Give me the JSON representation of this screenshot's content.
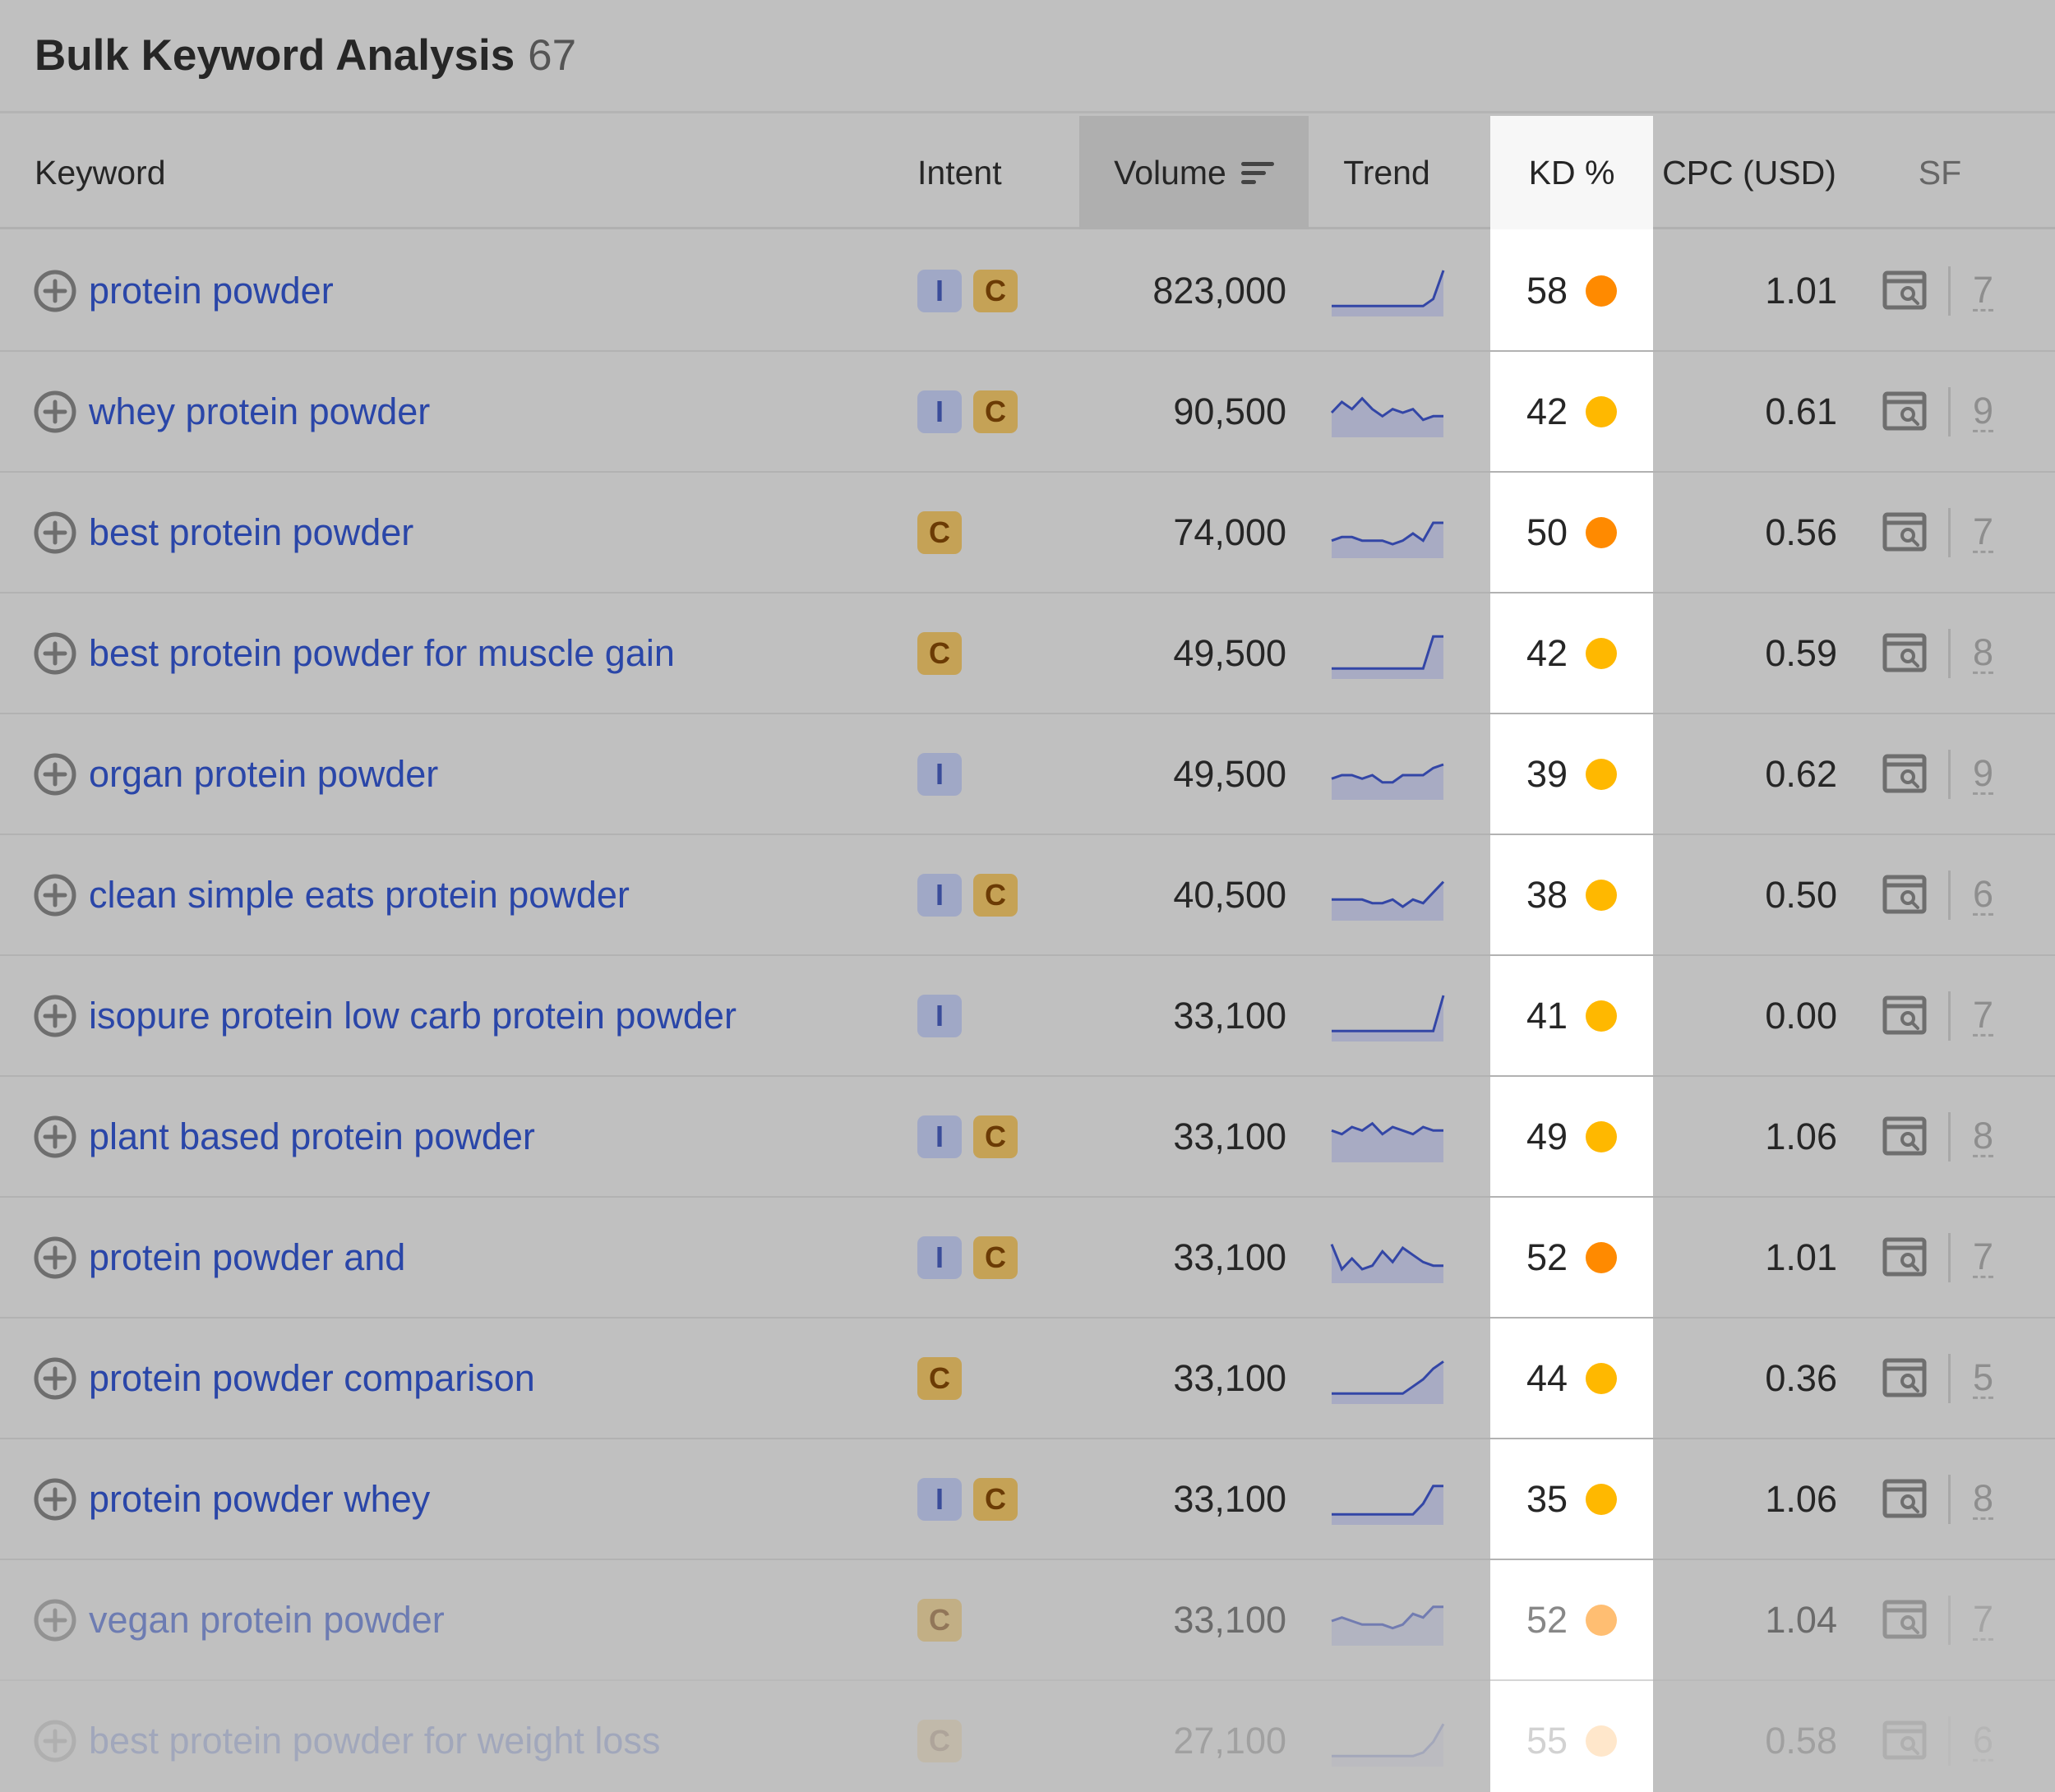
{
  "header": {
    "title": "Bulk Keyword Analysis",
    "count": "67"
  },
  "columns": {
    "keyword": "Keyword",
    "intent": "Intent",
    "volume": "Volume",
    "trend": "Trend",
    "kd": "KD %",
    "cpc": "CPC (USD)",
    "sf": "SF"
  },
  "colors": {
    "kd_orange": "#ff8a00",
    "kd_yellow": "#ffb800",
    "link": "#2a46a8",
    "intent_i": "#a0a8c6",
    "intent_c": "#c5a256"
  },
  "rows": [
    {
      "keyword": "protein powder",
      "intents": [
        "I",
        "C"
      ],
      "volume": "823,000",
      "trend": [
        2,
        2,
        2,
        2,
        2,
        2,
        2,
        2,
        2,
        2,
        4,
        12
      ],
      "kd": "58",
      "kd_color": "orange",
      "cpc": "1.01",
      "sf": "7"
    },
    {
      "keyword": "whey protein powder",
      "intents": [
        "I",
        "C"
      ],
      "volume": "90,500",
      "trend": [
        6,
        9,
        7,
        10,
        7,
        5,
        7,
        6,
        7,
        4,
        5,
        5
      ],
      "kd": "42",
      "kd_color": "yellow",
      "cpc": "0.61",
      "sf": "9"
    },
    {
      "keyword": "best protein powder",
      "intents": [
        "C"
      ],
      "volume": "74,000",
      "trend": [
        4,
        5,
        5,
        4,
        4,
        4,
        3,
        4,
        6,
        4,
        9,
        9
      ],
      "kd": "50",
      "kd_color": "orange",
      "cpc": "0.56",
      "sf": "7"
    },
    {
      "keyword": "best protein powder for muscle gain",
      "intents": [
        "C"
      ],
      "volume": "49,500",
      "trend": [
        2,
        2,
        2,
        2,
        2,
        2,
        2,
        2,
        2,
        2,
        11,
        11
      ],
      "kd": "42",
      "kd_color": "yellow",
      "cpc": "0.59",
      "sf": "8"
    },
    {
      "keyword": "organ protein powder",
      "intents": [
        "I"
      ],
      "volume": "49,500",
      "trend": [
        5,
        6,
        6,
        5,
        6,
        4,
        4,
        6,
        6,
        6,
        8,
        9
      ],
      "kd": "39",
      "kd_color": "yellow",
      "cpc": "0.62",
      "sf": "9"
    },
    {
      "keyword": "clean simple eats protein powder",
      "intents": [
        "I",
        "C"
      ],
      "volume": "40,500",
      "trend": [
        5,
        5,
        5,
        5,
        4,
        4,
        5,
        3,
        5,
        4,
        7,
        10
      ],
      "kd": "38",
      "kd_color": "yellow",
      "cpc": "0.50",
      "sf": "6"
    },
    {
      "keyword": "isopure protein low carb protein powder",
      "intents": [
        "I"
      ],
      "volume": "33,100",
      "trend": [
        2,
        2,
        2,
        2,
        2,
        2,
        2,
        2,
        2,
        2,
        2,
        12
      ],
      "kd": "41",
      "kd_color": "yellow",
      "cpc": "0.00",
      "sf": "7"
    },
    {
      "keyword": "plant based protein powder",
      "intents": [
        "I",
        "C"
      ],
      "volume": "33,100",
      "trend": [
        8,
        7,
        9,
        8,
        10,
        7,
        9,
        8,
        7,
        9,
        8,
        8
      ],
      "kd": "49",
      "kd_color": "yellow",
      "cpc": "1.06",
      "sf": "8"
    },
    {
      "keyword": "protein powder and",
      "intents": [
        "I",
        "C"
      ],
      "volume": "33,100",
      "trend": [
        10,
        3,
        6,
        3,
        4,
        8,
        5,
        9,
        7,
        5,
        4,
        4
      ],
      "kd": "52",
      "kd_color": "orange",
      "cpc": "1.01",
      "sf": "7"
    },
    {
      "keyword": "protein powder comparison",
      "intents": [
        "C"
      ],
      "volume": "33,100",
      "trend": [
        2,
        2,
        2,
        2,
        2,
        2,
        2,
        2,
        4,
        6,
        9,
        11
      ],
      "kd": "44",
      "kd_color": "yellow",
      "cpc": "0.36",
      "sf": "5"
    },
    {
      "keyword": "protein powder whey",
      "intents": [
        "I",
        "C"
      ],
      "volume": "33,100",
      "trend": [
        2,
        2,
        2,
        2,
        2,
        2,
        2,
        2,
        2,
        5,
        10,
        10
      ],
      "kd": "35",
      "kd_color": "yellow",
      "cpc": "1.06",
      "sf": "8"
    },
    {
      "keyword": "vegan protein powder",
      "intents": [
        "C"
      ],
      "volume": "33,100",
      "trend": [
        6,
        7,
        6,
        5,
        5,
        5,
        4,
        5,
        8,
        7,
        10,
        10
      ],
      "kd": "52",
      "kd_color": "orange",
      "cpc": "1.04",
      "sf": "7"
    },
    {
      "keyword": "best protein powder for weight loss",
      "intents": [
        "C"
      ],
      "volume": "27,100",
      "trend": [
        2,
        2,
        2,
        2,
        2,
        2,
        2,
        2,
        2,
        3,
        6,
        11
      ],
      "kd": "55",
      "kd_color": "orange",
      "cpc": "0.58",
      "sf": "6"
    }
  ]
}
